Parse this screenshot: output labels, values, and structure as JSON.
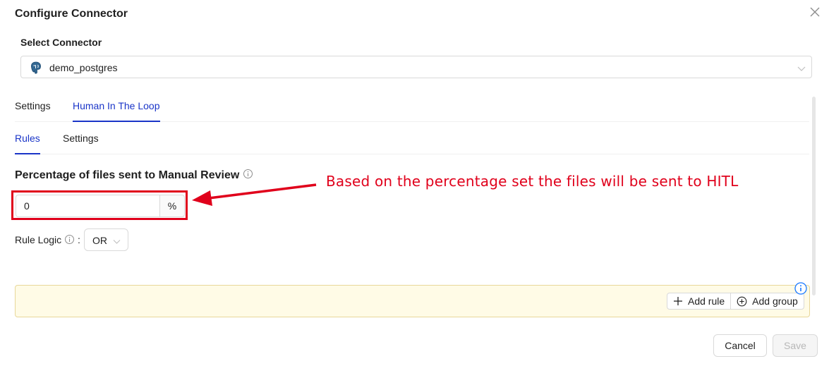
{
  "modal": {
    "title": "Configure Connector"
  },
  "connector": {
    "label": "Select Connector",
    "value": "demo_postgres"
  },
  "tabs": {
    "main": [
      "Settings",
      "Human In The Loop"
    ],
    "sub": [
      "Rules",
      "Settings"
    ]
  },
  "review": {
    "label": "Percentage of files sent to Manual Review",
    "value": "0",
    "unit": "%"
  },
  "annotation": {
    "text": "Based on the percentage set the files will be sent to HITL",
    "color": "#e0001b"
  },
  "rule_logic": {
    "label": "Rule Logic",
    "separator": ":",
    "value": "OR"
  },
  "rules_panel": {
    "add_rule": "Add rule",
    "add_group": "Add group"
  },
  "footer": {
    "cancel": "Cancel",
    "save": "Save"
  },
  "colors": {
    "accent": "#1a35c8",
    "panel_bg": "#fffbe6"
  }
}
